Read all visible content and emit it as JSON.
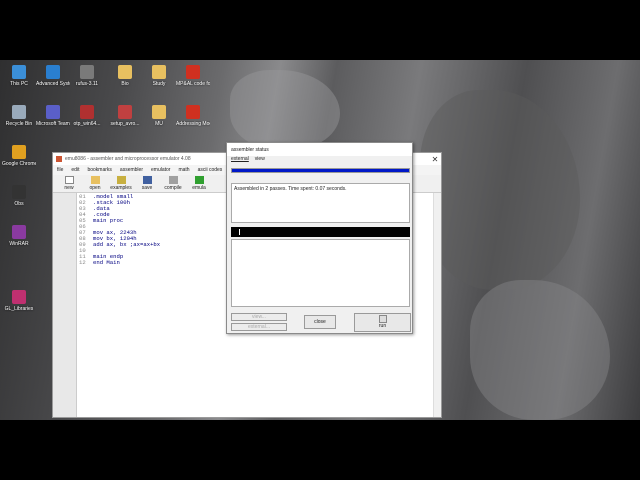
{
  "desktop": {
    "icons": [
      {
        "label": "This PC",
        "color": "#3b8fd8"
      },
      {
        "label": "Advanced SystemCare",
        "color": "#2a7fd0"
      },
      {
        "label": "rufus-3.11",
        "color": "#7a7a7a"
      },
      {
        "label": "Bio",
        "color": "#e8c060"
      },
      {
        "label": "Study",
        "color": "#e8c060"
      },
      {
        "label": "MP&AL code formal",
        "color": "#d03020"
      },
      {
        "label": "Recycle Bin",
        "color": "#9ab"
      },
      {
        "label": "Microsoft Teams",
        "color": "#5a5fc8"
      },
      {
        "label": "otp_win64...",
        "color": "#b03030"
      },
      {
        "label": "setup_avro...",
        "color": "#c04040"
      },
      {
        "label": "MU",
        "color": "#e8c060"
      },
      {
        "label": "Addressing Mode",
        "color": "#d03020"
      },
      {
        "label": "Google Chrome",
        "color": "#e0a020"
      },
      {
        "label": "Obs",
        "color": "#333"
      },
      {
        "label": "WinRAR",
        "color": "#8a3aa0"
      },
      {
        "label": "GL_Libraries",
        "color": "#c03070"
      }
    ]
  },
  "emu": {
    "title": "emu8086 - assembler and microprocessor emulator 4.08",
    "menu": [
      "file",
      "edit",
      "bookmarks",
      "assembler",
      "emulator",
      "math",
      "ascii codes"
    ],
    "toolbar": [
      "new",
      "open",
      "examples",
      "save",
      "compile",
      "emula"
    ],
    "code": [
      {
        "n": "01",
        "t": ".model small"
      },
      {
        "n": "02",
        "t": ".stack 100h"
      },
      {
        "n": "03",
        "t": ".data"
      },
      {
        "n": "04",
        "t": ".code"
      },
      {
        "n": "05",
        "t": "main proc"
      },
      {
        "n": "06",
        "t": ""
      },
      {
        "n": "07",
        "t": "mov ax, 2243h"
      },
      {
        "n": "08",
        "t": "mov bx, 1204h"
      },
      {
        "n": "09",
        "t": "add ax, bx ;ax=ax+bx"
      },
      {
        "n": "10",
        "t": ""
      },
      {
        "n": "11",
        "t": "main endp"
      },
      {
        "n": "12",
        "t": "end Main"
      }
    ]
  },
  "asm": {
    "title": "assembler status",
    "menu": [
      "external",
      "view"
    ],
    "progress": 1.0,
    "message": "Assembled in 2 passes. Time spent: 0.07 seconds.",
    "buttons": {
      "view": "view...",
      "external": "external...",
      "close": "close",
      "run": "run"
    }
  },
  "colors": {
    "progress": "#0018c8",
    "code": "#000080"
  }
}
